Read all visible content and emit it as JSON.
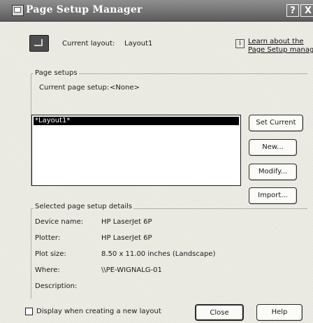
{
  "window": {
    "title": "Page Setup Manager",
    "help_glyph": "?",
    "close_glyph": "X"
  },
  "header": {
    "current_layout_label": "Current layout:",
    "current_layout_value": "Layout1",
    "learn_line1": "Learn about the",
    "learn_line2": "Page Setup manage"
  },
  "page_setups": {
    "group_label": "Page setups",
    "current_label": "Current page setup:",
    "current_value": "<None>",
    "items": [
      "*Layout1*"
    ],
    "selected_index": 0
  },
  "buttons": {
    "set_current": "Set Current",
    "new": "New...",
    "modify": "Modify...",
    "import": "Import..."
  },
  "details": {
    "group_label": "Selected page setup details",
    "rows": [
      {
        "key": "Device name:",
        "value": "HP LaserJet 6P"
      },
      {
        "key": "Plotter:",
        "value": "HP LaserJet 6P"
      },
      {
        "key": "Plot size:",
        "value": "8.50 x 11.00 inches (Landscape)"
      },
      {
        "key": "Where:",
        "value": "\\\\PE-WIGNALG-01"
      },
      {
        "key": "Description:",
        "value": ""
      }
    ]
  },
  "footer": {
    "checkbox_label": "Display when creating a new layout",
    "checkbox_checked": false,
    "close_label": "Close",
    "help_label": "Help"
  }
}
